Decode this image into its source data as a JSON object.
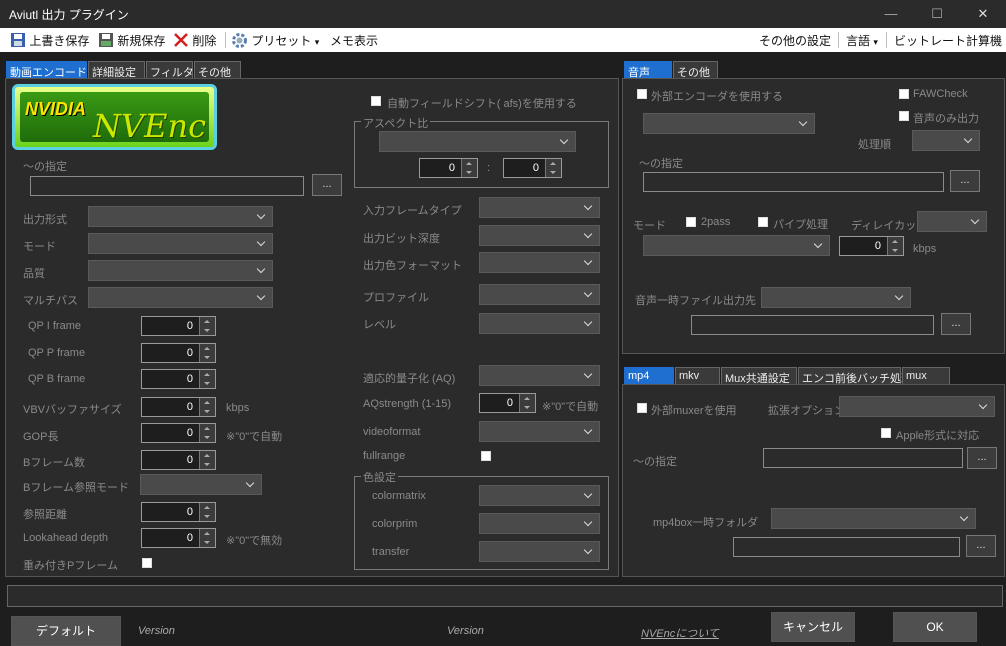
{
  "window": {
    "title": "Aviutl 出力 プラグイン",
    "min": "—",
    "max": "☐",
    "close": "✕"
  },
  "toolbar": {
    "overwrite": "上書き保存",
    "newsave": "新規保存",
    "delete": "削除",
    "preset": "プリセット",
    "preset_arrow": "▾",
    "memo": "メモ表示",
    "other_settings": "その他の設定",
    "language": "言語",
    "language_arrow": "▾",
    "bitrate_calc": "ビットレート計算機"
  },
  "left_tabs": [
    "動画エンコード",
    "詳細設定",
    "フィルタ",
    "その他"
  ],
  "logo": {
    "nvidia": "NVIDIA",
    "nvenc": "NVEnc"
  },
  "video": {
    "path_label": "～の指定",
    "browse": "...",
    "output_format": "出力形式",
    "mode": "モード",
    "quality": "品質",
    "multipass": "マルチパス",
    "qp_i": "QP I frame",
    "qp_p": "QP P frame",
    "qp_b": "QP B frame",
    "vbv": "VBVバッファサイズ",
    "gop": "GOP長",
    "bframes": "Bフレーム数",
    "bref": "Bフレーム参照モード",
    "ref": "参照距離",
    "lookahead": "Lookahead depth",
    "weighted": "重み付きPフレーム",
    "qp_i_val": "0",
    "qp_p_val": "0",
    "qp_b_val": "0",
    "vbv_val": "0",
    "gop_val": "0",
    "bframes_val": "0",
    "ref_val": "0",
    "lookahead_val": "0",
    "kbps": "kbps",
    "gop_note": "※\"0\"で自動",
    "lookahead_note": "※\"0\"で無効",
    "afs": "自動フィールドシフト( afs)を使用する",
    "aspect": "アスペクト比",
    "aspect_w": "0",
    "aspect_sep": ":",
    "aspect_h": "0",
    "input_frame_type": "入力フレームタイプ",
    "output_bit_depth": "出力ビット深度",
    "output_color_format": "出力色フォーマット",
    "profile": "プロファイル",
    "level": "レベル",
    "aq": "適応的量子化 (AQ)",
    "aqstrength": "AQstrength (1-15)",
    "aqstrength_val": "0",
    "aq_note": "※\"0\"で自動",
    "videoformat": "videoformat",
    "fullrange": "fullrange",
    "color_group": "色設定",
    "colormatrix": "colormatrix",
    "colorprim": "colorprim",
    "transfer": "transfer"
  },
  "audio_tabs": [
    "音声",
    "その他"
  ],
  "audio": {
    "external_encoder": "外部エンコーダを使用する",
    "faw": "FAWCheck",
    "audio_only": "音声のみ出力",
    "priority": "処理順",
    "path_label": "～の指定",
    "browse": "...",
    "mode": "モード",
    "twopass": "2pass",
    "pipe": "パイプ処理",
    "delay_cut": "ディレイカット",
    "bitrate_val": "0",
    "kbps": "kbps",
    "temp_dest": "音声一時ファイル出力先",
    "browse2": "..."
  },
  "mux_tabs": [
    "mp4",
    "mkv",
    "Mux共通設定",
    "エンコ前後バッチ処理",
    "mux"
  ],
  "mux": {
    "external_muxer": "外部muxerを使用",
    "ext_option": "拡張オプション",
    "apple": "Apple形式に対応",
    "path_label": "～の指定",
    "browse": "...",
    "mp4box_temp": "mp4box一時フォルダ",
    "browse2": "..."
  },
  "footer": {
    "default": "デフォルト",
    "version1": "Version",
    "version2": "Version",
    "about": "NVEncについて",
    "cancel": "キャンセル",
    "ok": "OK"
  }
}
